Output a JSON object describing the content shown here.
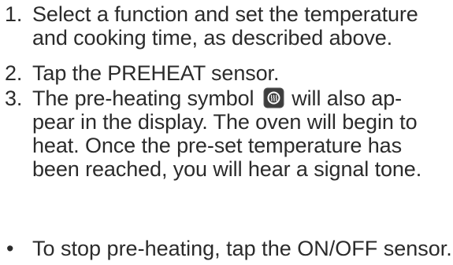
{
  "steps": [
    {
      "number": "1.",
      "lines": [
        "Select a function and set the temperature",
        "and cooking time, as described above."
      ]
    },
    {
      "number": "2.",
      "lines": [
        "Tap the PREHEAT sensor."
      ]
    },
    {
      "number": "3.",
      "line1_before_symbol": "The pre-heating symbol",
      "line1_after_symbol": "will also ap-",
      "lines_rest": [
        "pear in the display. The oven will begin to",
        "heat. Once the pre-set temperature has",
        "been reached, you will hear a signal tone."
      ],
      "symbol_icon": "preheat-symbol-icon"
    }
  ],
  "bullets": [
    {
      "marker": "•",
      "text": "To stop pre-heating, tap the ON/OFF sensor."
    }
  ],
  "colors": {
    "text": "#2b2b2b",
    "symbol_fill": "#4a4a4a",
    "background": "#ffffff"
  }
}
